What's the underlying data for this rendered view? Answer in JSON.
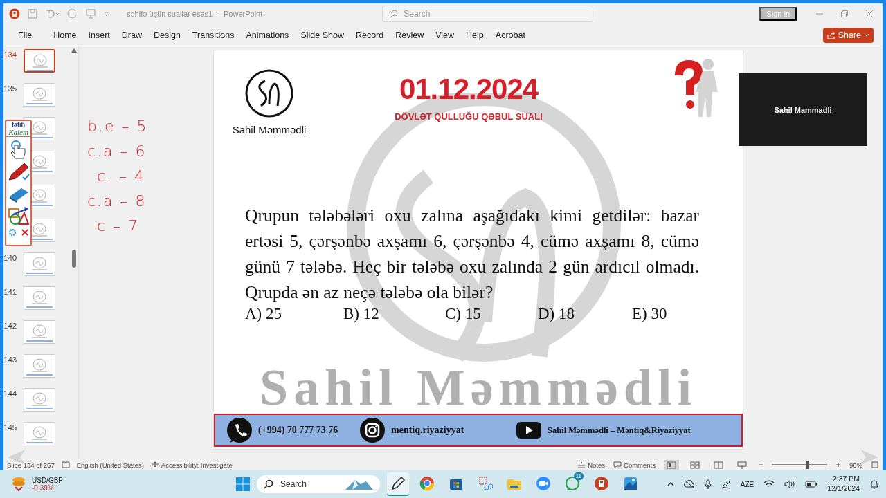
{
  "window": {
    "title": "səhifə üçün suallar esas1  -  PowerPoint",
    "search_placeholder": "Search",
    "sign_in": "Sign in"
  },
  "ribbon": {
    "tabs": [
      {
        "label": "File",
        "selected": false
      },
      {
        "label": "Home",
        "selected": false
      },
      {
        "label": "Insert",
        "selected": false
      },
      {
        "label": "Draw",
        "selected": false
      },
      {
        "label": "Design",
        "selected": false
      },
      {
        "label": "Transitions",
        "selected": false
      },
      {
        "label": "Animations",
        "selected": false
      },
      {
        "label": "Slide Show",
        "selected": false
      },
      {
        "label": "Record",
        "selected": false
      },
      {
        "label": "Review",
        "selected": false
      },
      {
        "label": "View",
        "selected": false
      },
      {
        "label": "Help",
        "selected": false
      },
      {
        "label": "Acrobat",
        "selected": false
      }
    ],
    "share": "Share"
  },
  "thumbnails": [
    {
      "number": "134",
      "selected": true
    },
    {
      "number": "135",
      "selected": false
    },
    {
      "selected": false
    },
    {
      "selected": false
    },
    {
      "selected": false
    },
    {
      "selected": false
    },
    {
      "number": "140",
      "selected": false
    },
    {
      "number": "141",
      "selected": false
    },
    {
      "number": "142",
      "selected": false
    },
    {
      "number": "143",
      "selected": false
    },
    {
      "number": "144",
      "selected": false
    },
    {
      "number": "145",
      "selected": false
    }
  ],
  "pen_toolbar": {
    "brand_top": "fatih",
    "brand_bottom": "Kalem"
  },
  "handwriting": [
    "b.e – 5",
    "c.a – 6",
    "c. – 4",
    "c.a – 8",
    "c – 7"
  ],
  "slide": {
    "author": "Sahil Məmmədli",
    "date": "01.12.2024",
    "subtitle": "DÖVLƏT QULLUĞU QƏBUL SUALI",
    "question": "Qrupun tələbələri oxu zalına aşağıdakı kimi getdilər: bazar ertəsi 5, çərşənbə axşamı 6, çərşənbə 4, cümə axşamı 8, cümə günü 7 tələbə. Heç bir tələbə oxu zalında 2 gün ardıcıl olmadı. Qrupda ən az neçə tələbə ola bilər?",
    "answers": [
      "A) 25",
      "B) 12",
      "C) 15",
      "D) 18",
      "E) 30"
    ],
    "signature": "Sahil Məmmədli",
    "footer": [
      {
        "kind": "phone",
        "text": "(+994) 70 777 73 76"
      },
      {
        "kind": "instagram",
        "text": "mentiq.riyaziyyat"
      },
      {
        "kind": "youtube",
        "text": "Sahil Məmmədli – Məntiq&Riyaziyyat"
      }
    ]
  },
  "video": {
    "name": "Sahil Mammadli"
  },
  "status_bar": {
    "slide": "Slide 134 of 257",
    "language": "English (United States)",
    "accessibility": "Accessibility: Investigate",
    "notes": "Notes",
    "comments": "Comments",
    "views": [
      {
        "kind": "normal",
        "selected": true
      },
      {
        "kind": "sorter",
        "selected": false
      },
      {
        "kind": "reading",
        "selected": false
      },
      {
        "kind": "show",
        "selected": false
      }
    ],
    "zoom": "96%",
    "level": 0.62
  },
  "taskbar": {
    "widget_title": "USD/GBP",
    "widget_value": "-0.39%",
    "search": "Search",
    "apps": [
      {
        "kind": "pen",
        "active": true
      },
      {
        "kind": "chrome",
        "active": false
      },
      {
        "kind": "store",
        "active": false
      },
      {
        "kind": "snip",
        "active": false
      },
      {
        "kind": "files",
        "active": false
      },
      {
        "kind": "zoom",
        "active": false
      },
      {
        "kind": "whatsapp",
        "active": false,
        "badge": "11"
      },
      {
        "kind": "powerpoint",
        "active": false
      },
      {
        "kind": "photos",
        "active": false
      }
    ],
    "language": "AZE",
    "time": "2:37 PM",
    "date": "12/1/2024"
  }
}
